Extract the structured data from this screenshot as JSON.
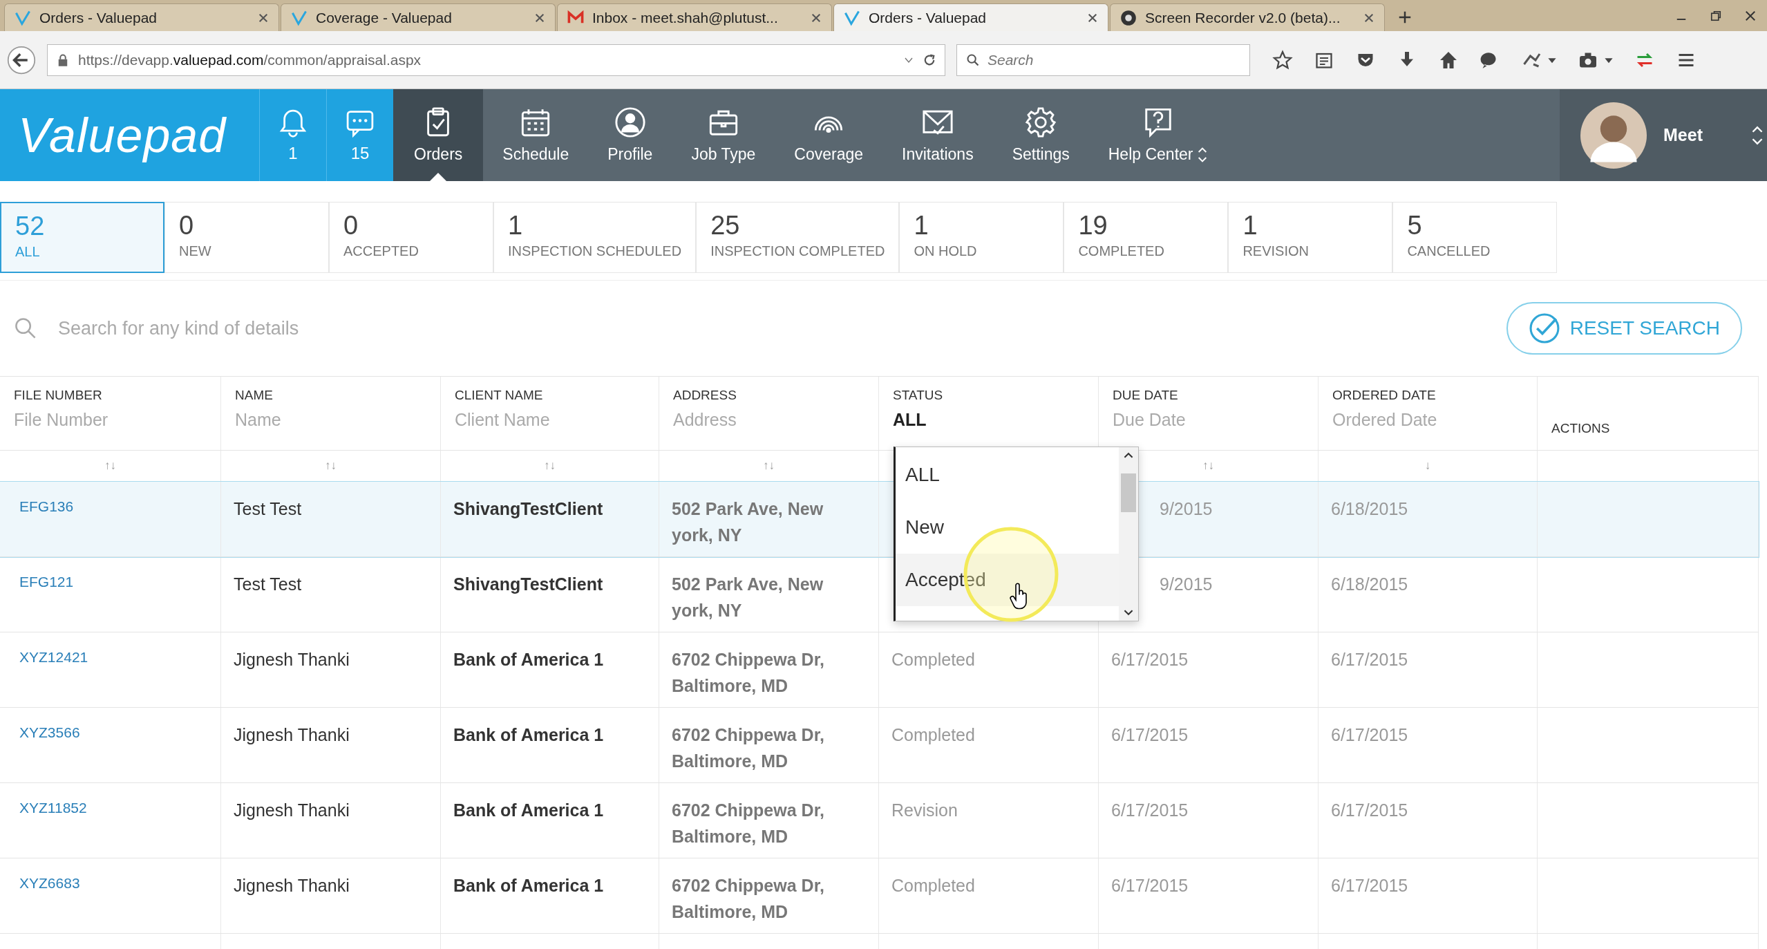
{
  "browser": {
    "tabs": [
      {
        "title": "Orders - Valuepad",
        "kind": "valuepad",
        "selected": false
      },
      {
        "title": "Coverage - Valuepad",
        "kind": "valuepad",
        "selected": false
      },
      {
        "title": "Inbox - meet.shah@plutust...",
        "kind": "mail",
        "selected": false
      },
      {
        "title": "Orders - Valuepad",
        "kind": "valuepad",
        "selected": true
      },
      {
        "title": "Screen Recorder v2.0 (beta)...",
        "kind": "recorder",
        "selected": false
      }
    ],
    "url": {
      "prefix": "https://devapp.",
      "domain": "valuepad.com",
      "path": "/common/appraisal.aspx"
    },
    "search": {
      "placeholder": "Search"
    }
  },
  "nav": {
    "logo": "Valuepad",
    "counters": [
      {
        "kind": "bell",
        "count": "1"
      },
      {
        "kind": "chat",
        "count": "15"
      }
    ],
    "items": [
      {
        "label": "Orders",
        "kind": "clipboard",
        "selected": true
      },
      {
        "label": "Schedule",
        "kind": "calendar",
        "selected": false
      },
      {
        "label": "Profile",
        "kind": "person",
        "selected": false
      },
      {
        "label": "Job Type",
        "kind": "briefcase",
        "selected": false
      },
      {
        "label": "Coverage",
        "kind": "signal",
        "selected": false
      },
      {
        "label": "Invitations",
        "kind": "envelope",
        "selected": false
      },
      {
        "label": "Settings",
        "kind": "gear",
        "selected": false
      },
      {
        "label": "Help Center",
        "kind": "help",
        "selected": false
      }
    ],
    "user": {
      "name": "Meet"
    }
  },
  "status_tabs": [
    {
      "count": "52",
      "label": "ALL",
      "selected": true
    },
    {
      "count": "0",
      "label": "NEW",
      "selected": false
    },
    {
      "count": "0",
      "label": "ACCEPTED",
      "selected": false
    },
    {
      "count": "1",
      "label": "INSPECTION SCHEDULED",
      "selected": false
    },
    {
      "count": "25",
      "label": "INSPECTION COMPLETED",
      "selected": false
    },
    {
      "count": "1",
      "label": "ON HOLD",
      "selected": false
    },
    {
      "count": "19",
      "label": "COMPLETED",
      "selected": false
    },
    {
      "count": "1",
      "label": "REVISION",
      "selected": false
    },
    {
      "count": "5",
      "label": "CANCELLED",
      "selected": false
    }
  ],
  "search": {
    "placeholder": "Search for any kind of details"
  },
  "reset_button": "RESET SEARCH",
  "table": {
    "columns": [
      {
        "label": "FILE NUMBER",
        "placeholder": "File Number",
        "sort": "↑↓"
      },
      {
        "label": "NAME",
        "placeholder": "Name",
        "sort": "↑↓"
      },
      {
        "label": "CLIENT NAME",
        "placeholder": "Client Name",
        "sort": "↑↓"
      },
      {
        "label": "ADDRESS",
        "placeholder": "Address",
        "sort": "↑↓"
      },
      {
        "label": "STATUS",
        "value": "ALL"
      },
      {
        "label": "DUE DATE",
        "placeholder": "Due Date",
        "sort": "↑↓"
      },
      {
        "label": "ORDERED DATE",
        "placeholder": "Ordered Date",
        "sort": "↓"
      },
      {
        "label": "ACTIONS"
      }
    ],
    "rows": [
      {
        "file_number": "EFG136",
        "name": "Test Test",
        "client_name": "ShivangTestClient",
        "address": "502 Park Ave, New york, NY",
        "due_date": "9/2015",
        "ordered_date": "6/18/2015",
        "selected": true,
        "partly_hidden": true
      },
      {
        "file_number": "EFG121",
        "name": "Test Test",
        "client_name": "ShivangTestClient",
        "address": "502 Park Ave, New york, NY",
        "due_date": "9/2015",
        "ordered_date": "6/18/2015",
        "selected": false,
        "partly_hidden": true
      },
      {
        "file_number": "XYZ12421",
        "name": "Jignesh Thanki",
        "client_name": "Bank of America 1",
        "address": "6702 Chippewa Dr, Baltimore, MD",
        "status": "Completed",
        "due_date": "6/17/2015",
        "ordered_date": "6/17/2015",
        "selected": false,
        "partly_hidden": false
      },
      {
        "file_number": "XYZ3566",
        "name": "Jignesh Thanki",
        "client_name": "Bank of America 1",
        "address": "6702 Chippewa Dr, Baltimore, MD",
        "status": "Completed",
        "due_date": "6/17/2015",
        "ordered_date": "6/17/2015",
        "selected": false,
        "partly_hidden": false
      },
      {
        "file_number": "XYZ11852",
        "name": "Jignesh Thanki",
        "client_name": "Bank of America 1",
        "address": "6702 Chippewa Dr, Baltimore, MD",
        "status": "Revision",
        "due_date": "6/17/2015",
        "ordered_date": "6/17/2015",
        "selected": false,
        "partly_hidden": false
      },
      {
        "file_number": "XYZ6683",
        "name": "Jignesh Thanki",
        "client_name": "Bank of America 1",
        "address": "6702 Chippewa Dr, Baltimore, MD",
        "status": "Completed",
        "due_date": "6/17/2015",
        "ordered_date": "6/17/2015",
        "selected": false,
        "partly_hidden": false
      }
    ]
  },
  "status_dropdown": {
    "options": [
      {
        "label": "ALL",
        "hovered": false
      },
      {
        "label": "New",
        "hovered": false
      },
      {
        "label": "Accepted",
        "hovered": true
      }
    ]
  }
}
